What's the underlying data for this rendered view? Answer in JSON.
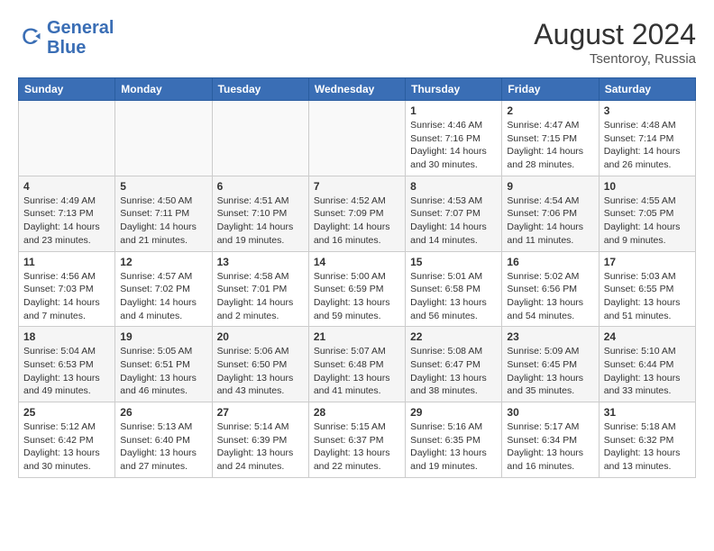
{
  "header": {
    "logo_text_general": "General",
    "logo_text_blue": "Blue",
    "month_year": "August 2024",
    "location": "Tsentoroy, Russia"
  },
  "days_of_week": [
    "Sunday",
    "Monday",
    "Tuesday",
    "Wednesday",
    "Thursday",
    "Friday",
    "Saturday"
  ],
  "weeks": [
    [
      {
        "day": "",
        "content": ""
      },
      {
        "day": "",
        "content": ""
      },
      {
        "day": "",
        "content": ""
      },
      {
        "day": "",
        "content": ""
      },
      {
        "day": "1",
        "content": "Sunrise: 4:46 AM\nSunset: 7:16 PM\nDaylight: 14 hours\nand 30 minutes."
      },
      {
        "day": "2",
        "content": "Sunrise: 4:47 AM\nSunset: 7:15 PM\nDaylight: 14 hours\nand 28 minutes."
      },
      {
        "day": "3",
        "content": "Sunrise: 4:48 AM\nSunset: 7:14 PM\nDaylight: 14 hours\nand 26 minutes."
      }
    ],
    [
      {
        "day": "4",
        "content": "Sunrise: 4:49 AM\nSunset: 7:13 PM\nDaylight: 14 hours\nand 23 minutes."
      },
      {
        "day": "5",
        "content": "Sunrise: 4:50 AM\nSunset: 7:11 PM\nDaylight: 14 hours\nand 21 minutes."
      },
      {
        "day": "6",
        "content": "Sunrise: 4:51 AM\nSunset: 7:10 PM\nDaylight: 14 hours\nand 19 minutes."
      },
      {
        "day": "7",
        "content": "Sunrise: 4:52 AM\nSunset: 7:09 PM\nDaylight: 14 hours\nand 16 minutes."
      },
      {
        "day": "8",
        "content": "Sunrise: 4:53 AM\nSunset: 7:07 PM\nDaylight: 14 hours\nand 14 minutes."
      },
      {
        "day": "9",
        "content": "Sunrise: 4:54 AM\nSunset: 7:06 PM\nDaylight: 14 hours\nand 11 minutes."
      },
      {
        "day": "10",
        "content": "Sunrise: 4:55 AM\nSunset: 7:05 PM\nDaylight: 14 hours\nand 9 minutes."
      }
    ],
    [
      {
        "day": "11",
        "content": "Sunrise: 4:56 AM\nSunset: 7:03 PM\nDaylight: 14 hours\nand 7 minutes."
      },
      {
        "day": "12",
        "content": "Sunrise: 4:57 AM\nSunset: 7:02 PM\nDaylight: 14 hours\nand 4 minutes."
      },
      {
        "day": "13",
        "content": "Sunrise: 4:58 AM\nSunset: 7:01 PM\nDaylight: 14 hours\nand 2 minutes."
      },
      {
        "day": "14",
        "content": "Sunrise: 5:00 AM\nSunset: 6:59 PM\nDaylight: 13 hours\nand 59 minutes."
      },
      {
        "day": "15",
        "content": "Sunrise: 5:01 AM\nSunset: 6:58 PM\nDaylight: 13 hours\nand 56 minutes."
      },
      {
        "day": "16",
        "content": "Sunrise: 5:02 AM\nSunset: 6:56 PM\nDaylight: 13 hours\nand 54 minutes."
      },
      {
        "day": "17",
        "content": "Sunrise: 5:03 AM\nSunset: 6:55 PM\nDaylight: 13 hours\nand 51 minutes."
      }
    ],
    [
      {
        "day": "18",
        "content": "Sunrise: 5:04 AM\nSunset: 6:53 PM\nDaylight: 13 hours\nand 49 minutes."
      },
      {
        "day": "19",
        "content": "Sunrise: 5:05 AM\nSunset: 6:51 PM\nDaylight: 13 hours\nand 46 minutes."
      },
      {
        "day": "20",
        "content": "Sunrise: 5:06 AM\nSunset: 6:50 PM\nDaylight: 13 hours\nand 43 minutes."
      },
      {
        "day": "21",
        "content": "Sunrise: 5:07 AM\nSunset: 6:48 PM\nDaylight: 13 hours\nand 41 minutes."
      },
      {
        "day": "22",
        "content": "Sunrise: 5:08 AM\nSunset: 6:47 PM\nDaylight: 13 hours\nand 38 minutes."
      },
      {
        "day": "23",
        "content": "Sunrise: 5:09 AM\nSunset: 6:45 PM\nDaylight: 13 hours\nand 35 minutes."
      },
      {
        "day": "24",
        "content": "Sunrise: 5:10 AM\nSunset: 6:44 PM\nDaylight: 13 hours\nand 33 minutes."
      }
    ],
    [
      {
        "day": "25",
        "content": "Sunrise: 5:12 AM\nSunset: 6:42 PM\nDaylight: 13 hours\nand 30 minutes."
      },
      {
        "day": "26",
        "content": "Sunrise: 5:13 AM\nSunset: 6:40 PM\nDaylight: 13 hours\nand 27 minutes."
      },
      {
        "day": "27",
        "content": "Sunrise: 5:14 AM\nSunset: 6:39 PM\nDaylight: 13 hours\nand 24 minutes."
      },
      {
        "day": "28",
        "content": "Sunrise: 5:15 AM\nSunset: 6:37 PM\nDaylight: 13 hours\nand 22 minutes."
      },
      {
        "day": "29",
        "content": "Sunrise: 5:16 AM\nSunset: 6:35 PM\nDaylight: 13 hours\nand 19 minutes."
      },
      {
        "day": "30",
        "content": "Sunrise: 5:17 AM\nSunset: 6:34 PM\nDaylight: 13 hours\nand 16 minutes."
      },
      {
        "day": "31",
        "content": "Sunrise: 5:18 AM\nSunset: 6:32 PM\nDaylight: 13 hours\nand 13 minutes."
      }
    ]
  ]
}
